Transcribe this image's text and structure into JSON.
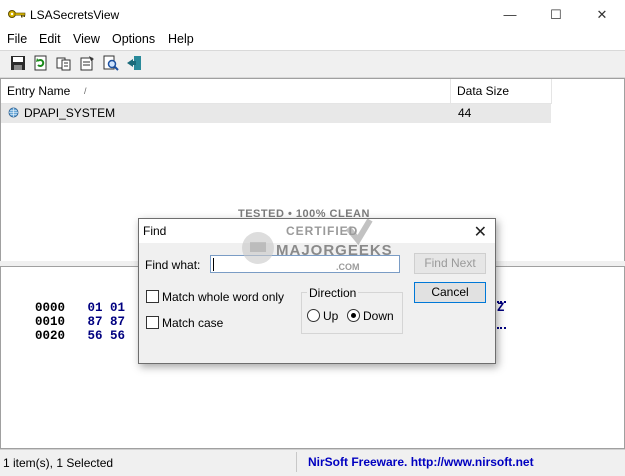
{
  "window": {
    "title": "LSASecretsView",
    "icon": "key-icon",
    "minimize_glyph": "—",
    "maximize_glyph": "☐",
    "close_glyph": "✕"
  },
  "menu": {
    "items": [
      "File",
      "Edit",
      "View",
      "Options",
      "Help"
    ]
  },
  "toolbar": {
    "buttons": [
      "save-icon",
      "refresh-icon",
      "copy-icon",
      "properties-icon",
      "find-icon",
      "exit-icon"
    ]
  },
  "list": {
    "columns": [
      {
        "label": "Entry Name",
        "sort_indicator": "/"
      },
      {
        "label": "Data Size"
      }
    ],
    "rows": [
      {
        "name": "DPAPI_SYSTEM",
        "size": "44",
        "icon": "globe-icon",
        "selected": true
      }
    ]
  },
  "hex": {
    "lines": [
      {
        "offset": "0000",
        "bytes": "01 01  01 01",
        "right": ""
      },
      {
        "offset": "0010",
        "bytes": "87 87  87 87",
        "right": "Z"
      },
      {
        "offset": "0020",
        "bytes": "56 56  56 56",
        "right": ""
      }
    ]
  },
  "status": {
    "items": "1 item(s), 1 Selected",
    "credit": "NirSoft Freeware.  http://www.nirsoft.net"
  },
  "find_dialog": {
    "title": "Find",
    "close_glyph": "✕",
    "find_what_label": "Find what:",
    "find_what_value": "",
    "find_next_label": "Find Next",
    "cancel_label": "Cancel",
    "match_whole_word_label": "Match whole word only",
    "match_case_label": "Match case",
    "match_whole_word_checked": false,
    "match_case_checked": false,
    "direction_label": "Direction",
    "up_label": "Up",
    "down_label": "Down",
    "direction_selected": "Down"
  },
  "watermark": {
    "line1": "TESTED • 100% CLEAN",
    "line2": "CERTIFIED",
    "line3": "MAJORGEEKS",
    "line4": ".COM"
  }
}
